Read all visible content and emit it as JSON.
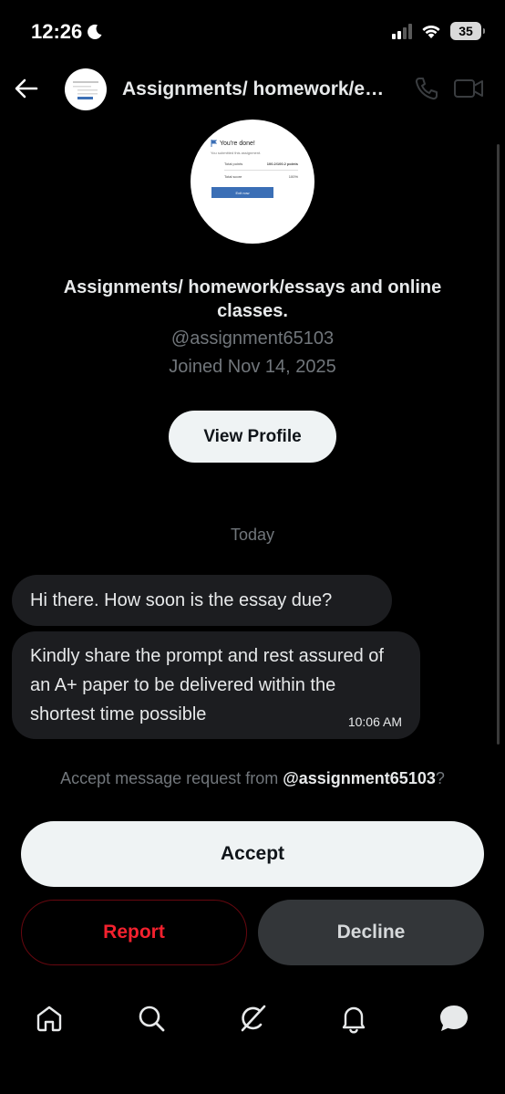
{
  "status_bar": {
    "time": "12:26",
    "battery": "35",
    "moon_icon": "moon-icon",
    "signal_icon": "cellular-signal-icon",
    "wifi_icon": "wifi-icon"
  },
  "header": {
    "title": "Assignments/ homework/essays and online classes.",
    "back_icon": "arrow-left-icon",
    "call_icon": "phone-icon",
    "video_icon": "video-camera-icon"
  },
  "profile": {
    "name": "Assignments/ homework/essays and online classes.",
    "handle": "@assignment65103",
    "joined": "Joined Nov 14, 2025",
    "view_profile_label": "View Profile",
    "avatar_card": {
      "heading": "You're done!",
      "subtext": "You submitted this assignment.",
      "row1_label": "Total points",
      "row1_value": "100.2/100.2 points",
      "row2_label": "Total score",
      "row2_value": "100%",
      "button": "Exit now"
    }
  },
  "conversation": {
    "date_separator": "Today",
    "messages": [
      {
        "text": "Hi there.  How soon is the essay due?"
      },
      {
        "text": "Kindly share the prompt and rest assured of an A+ paper to be delivered within the shortest time possible",
        "time": "10:06 AM"
      }
    ]
  },
  "request": {
    "prefix": "Accept message request from ",
    "handle": "@assignment65103",
    "suffix": "?",
    "accept_label": "Accept",
    "report_label": "Report",
    "decline_label": "Decline"
  },
  "bottom_nav": [
    {
      "icon": "home-icon"
    },
    {
      "icon": "search-icon"
    },
    {
      "icon": "grok-icon"
    },
    {
      "icon": "bell-icon"
    },
    {
      "icon": "messages-icon"
    }
  ],
  "colors": {
    "background": "#000000",
    "text_primary": "#e7e9ea",
    "text_secondary": "#71767b",
    "bubble": "#1c1d20",
    "report_red": "#f4212e",
    "decline_bg": "#333639",
    "accept_bg": "#eff3f4"
  }
}
